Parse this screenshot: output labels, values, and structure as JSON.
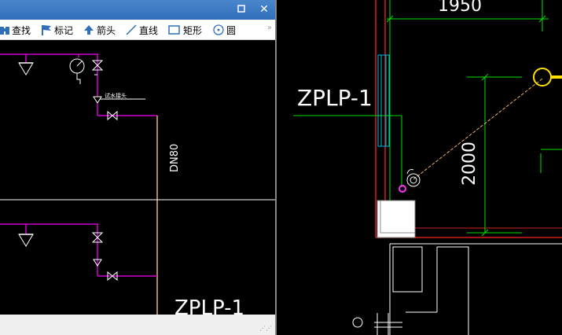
{
  "titlebar": {
    "minimize_icon": "minimize-icon",
    "close_icon": "close-icon"
  },
  "toolbar": {
    "tools": [
      {
        "label": "查找",
        "icon": "binoculars-icon"
      },
      {
        "label": "标记",
        "icon": "flag-icon"
      },
      {
        "label": "箭头",
        "icon": "arrow-up-icon"
      },
      {
        "label": "直线",
        "icon": "line-icon"
      },
      {
        "label": "矩形",
        "icon": "rectangle-icon"
      },
      {
        "label": "圆",
        "icon": "circle-icon"
      }
    ],
    "overflow_icon": "chevron-double-right-icon"
  },
  "left_drawing": {
    "pipe_label": "DN80",
    "tag_label": "ZPLP-1",
    "small_note": "试水接头"
  },
  "main_drawing": {
    "top_dimension": "1950",
    "side_dimension": "2000",
    "tag_label": "ZPLP-1"
  },
  "colors": {
    "pipe_magenta": "#d000d0",
    "pipe_orange": "#f0b070",
    "dim_green": "#00e000",
    "wall_red": "#d02020",
    "cyan": "#00c0e0",
    "highlight_yellow": "#ffe000",
    "title_blue": "#2f6fb9"
  }
}
